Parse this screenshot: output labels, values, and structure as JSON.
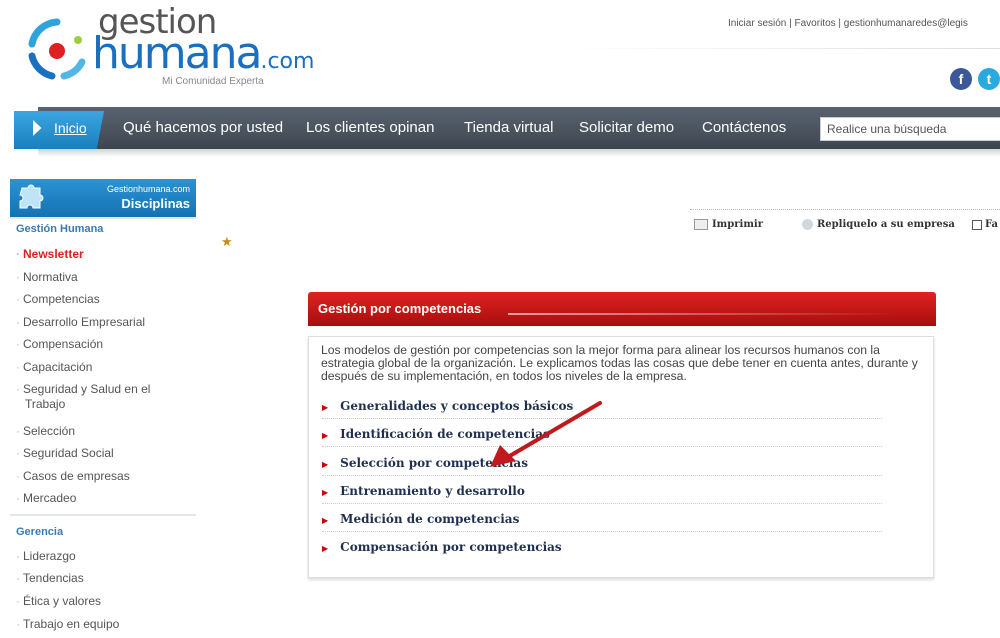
{
  "header": {
    "logo_line1": "gestion",
    "logo_line2": "humana",
    "logo_suffix": ".com",
    "logo_tagline": "Mi Comunidad Experta",
    "top_links": "Iniciar sesión | Favoritos | gestionhumanaredes@legis",
    "social": [
      {
        "name": "facebook-icon",
        "glyph": "f",
        "color": "#3b5998"
      },
      {
        "name": "twitter-icon",
        "glyph": "t",
        "color": "#2aa9e0"
      }
    ]
  },
  "nav": {
    "home": "Inicio",
    "items": [
      "Qué hacemos por usted",
      "Los clientes opinan",
      "Tienda virtual",
      "Solicitar demo",
      "Contáctenos"
    ],
    "search_placeholder": "Realice una búsqueda"
  },
  "sidebar": {
    "box_top": "Gestionhumana.com",
    "box_title": "Disciplinas",
    "section1_title": "Gestión Humana",
    "section1_items": [
      "Newsletter",
      "Normativa",
      "Competencias",
      "Desarrollo Empresarial",
      "Compensación",
      "Capacitación",
      "Seguridad y Salud en el",
      "Trabajo",
      "Selección",
      "Seguridad Social",
      "Casos de empresas",
      "Mercadeo"
    ],
    "section2_title": "Gerencia",
    "section2_items": [
      "Liderazgo",
      "Tendencias",
      "Ética y valores",
      "Trabajo en equipo"
    ]
  },
  "actions": {
    "print": "Imprimir",
    "share": "Repliquelo a su empresa",
    "fav": "Fa"
  },
  "panel": {
    "title": "Gestión por competencias",
    "intro": "Los modelos de gestión por competencias son la mejor forma para alinear los recursos humanos con la estrategia global de la organización. Le explicamos todas las cosas que debe tener en cuenta antes, durante y después de su implementación, en todos los niveles de la empresa.",
    "links": [
      "Generalidades y conceptos básicos",
      "Identificación de competencias",
      "Selección por competencias",
      "Entrenamiento y desarrollo",
      "Medición de competencias",
      "Compensación por competencias"
    ]
  },
  "colors": {
    "brand_blue": "#1a6fbf",
    "panel_red": "#d01818",
    "active_red": "#e02020",
    "annotation_arrow": "#c0191e"
  }
}
